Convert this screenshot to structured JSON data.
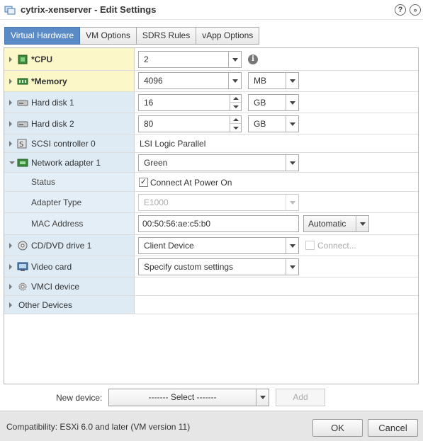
{
  "window": {
    "title": "cytrix-xenserver - Edit Settings",
    "help_label": "?",
    "expand_label": "»"
  },
  "tabs": [
    {
      "label": "Virtual Hardware",
      "active": true
    },
    {
      "label": "VM Options",
      "active": false
    },
    {
      "label": "SDRS Rules",
      "active": false
    },
    {
      "label": "vApp Options",
      "active": false
    }
  ],
  "devices": {
    "cpu": {
      "label": "*CPU",
      "value": "2",
      "info_label": "i"
    },
    "memory": {
      "label": "*Memory",
      "value": "4096",
      "unit": "MB"
    },
    "hard_disk_1": {
      "label": "Hard disk 1",
      "value": "16",
      "unit": "GB"
    },
    "hard_disk_2": {
      "label": "Hard disk 2",
      "value": "80",
      "unit": "GB"
    },
    "scsi_controller": {
      "label": "SCSI controller 0",
      "value": "LSI Logic Parallel"
    },
    "network_adapter": {
      "label": "Network adapter 1",
      "network": "Green",
      "status_label": "Status",
      "status_checkbox_label": "Connect At Power On",
      "status_checked": true,
      "adapter_type_label": "Adapter Type",
      "adapter_type": "E1000",
      "mac_label": "MAC Address",
      "mac_value": "00:50:56:ae:c5:b0",
      "mac_mode": "Automatic"
    },
    "cd_dvd": {
      "label": "CD/DVD drive 1",
      "value": "Client Device",
      "connect_label": "Connect..."
    },
    "video_card": {
      "label": "Video card",
      "value": "Specify custom settings"
    },
    "vmci": {
      "label": "VMCI device"
    },
    "other": {
      "label": "Other Devices"
    }
  },
  "new_device": {
    "label": "New device:",
    "select_value": "------- Select -------",
    "add_label": "Add"
  },
  "footer": {
    "compatibility": "Compatibility: ESXi 6.0 and later (VM version 11)",
    "ok_label": "OK",
    "cancel_label": "Cancel"
  },
  "colors": {
    "tab_active": "#5b8bc6",
    "row_label_bg": "#deebf5",
    "row_label_highlight": "#fbf7c8",
    "footer_bg": "#e6e6e6"
  }
}
